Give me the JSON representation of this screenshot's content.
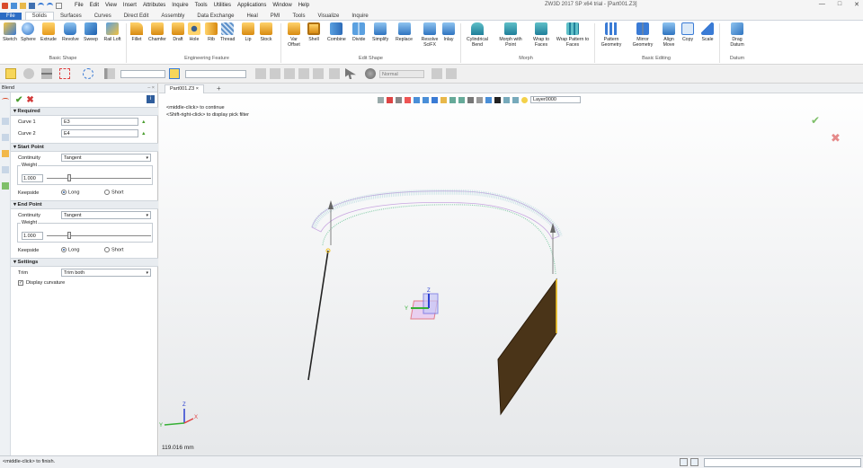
{
  "app": {
    "title": "ZW3D 2017 SP x64 trial - [Part001.Z3]",
    "menu": [
      "File",
      "Edit",
      "View",
      "Insert",
      "Attributes",
      "Inquire",
      "Tools",
      "Utilities",
      "Applications",
      "Window",
      "Help"
    ]
  },
  "ribbon_tabs": [
    "File",
    "Solids",
    "Surfaces",
    "Curves",
    "Direct Edit",
    "Assembly",
    "Data Exchange",
    "Heal",
    "PMI",
    "Tools",
    "Visualize",
    "Inquire"
  ],
  "ribbon": {
    "basic_shape": {
      "label": "Basic Shape",
      "buttons": [
        "Sketch",
        "Sphere",
        "Extrude",
        "Revolve",
        "Sweep",
        "Rail Loft"
      ]
    },
    "engineering_feature": {
      "label": "Engineering Feature",
      "buttons": [
        "Fillet",
        "Chamfer",
        "Draft",
        "Hole",
        "Rib",
        "Thread",
        "Lip",
        "Stock"
      ]
    },
    "edit_shape": {
      "label": "Edit Shape",
      "buttons": [
        "Var Offset",
        "Shell",
        "Combine",
        "Divide",
        "Simplify",
        "Replace",
        "Resolve SciFX",
        "Inlay"
      ]
    },
    "morph": {
      "label": "Morph",
      "buttons": [
        "Cylindrical Bend",
        "Morph with Point",
        "Wrap to Faces",
        "Wrap Pattern to Faces"
      ]
    },
    "basic_editing": {
      "label": "Basic Editing",
      "buttons": [
        "Pattern Geometry",
        "Mirror Geometry",
        "Align Move",
        "Copy",
        "Scale"
      ]
    },
    "datum": {
      "label": "Datum",
      "buttons": [
        "Drag Datum"
      ]
    }
  },
  "toolbar": {
    "render_mode": "Normal"
  },
  "panel": {
    "title": "Blend",
    "required": {
      "label": "Required",
      "curve1_label": "Curve 1",
      "curve1_value": "E3",
      "curve2_label": "Curve 2",
      "curve2_value": "E4"
    },
    "start_point": {
      "label": "Start Point",
      "continuity_label": "Continuity",
      "continuity_value": "Tangent",
      "weight_label": "Weight",
      "weight_value": "1.000",
      "weight_fraction": 0.3,
      "keepside_label": "Keepside",
      "opt_long": "Long",
      "opt_short": "Short",
      "selected": "Long"
    },
    "end_point": {
      "label": "End Point",
      "continuity_label": "Continuity",
      "continuity_value": "Tangent",
      "weight_label": "Weight",
      "weight_value": "1.000",
      "weight_fraction": 0.3,
      "keepside_label": "Keepside",
      "opt_long": "Long",
      "opt_short": "Short",
      "selected": "Long"
    },
    "settings": {
      "label": "Settings",
      "trim_label": "Trim",
      "trim_value": "Trim both",
      "display_curvature": "Display curvature",
      "display_curvature_checked": true
    }
  },
  "viewport": {
    "tab_label": "Part001.Z3",
    "layer": "Layer0000",
    "hint1": "<middle-click> to continue",
    "hint2": "<Shift-right-click> to display pick filter",
    "scale_text": "119.016 mm",
    "axis_labels": {
      "x": "X",
      "y": "Y",
      "z": "Z"
    }
  },
  "status": {
    "text": "<middle-click> to finish."
  },
  "colors": {
    "accent": "#2b6cc4",
    "ok": "#7fbf6a",
    "cancel": "#e58a8a",
    "surface": "#4a3418",
    "curve_edge": "#f0c020",
    "comb": "#8fd0b0"
  }
}
